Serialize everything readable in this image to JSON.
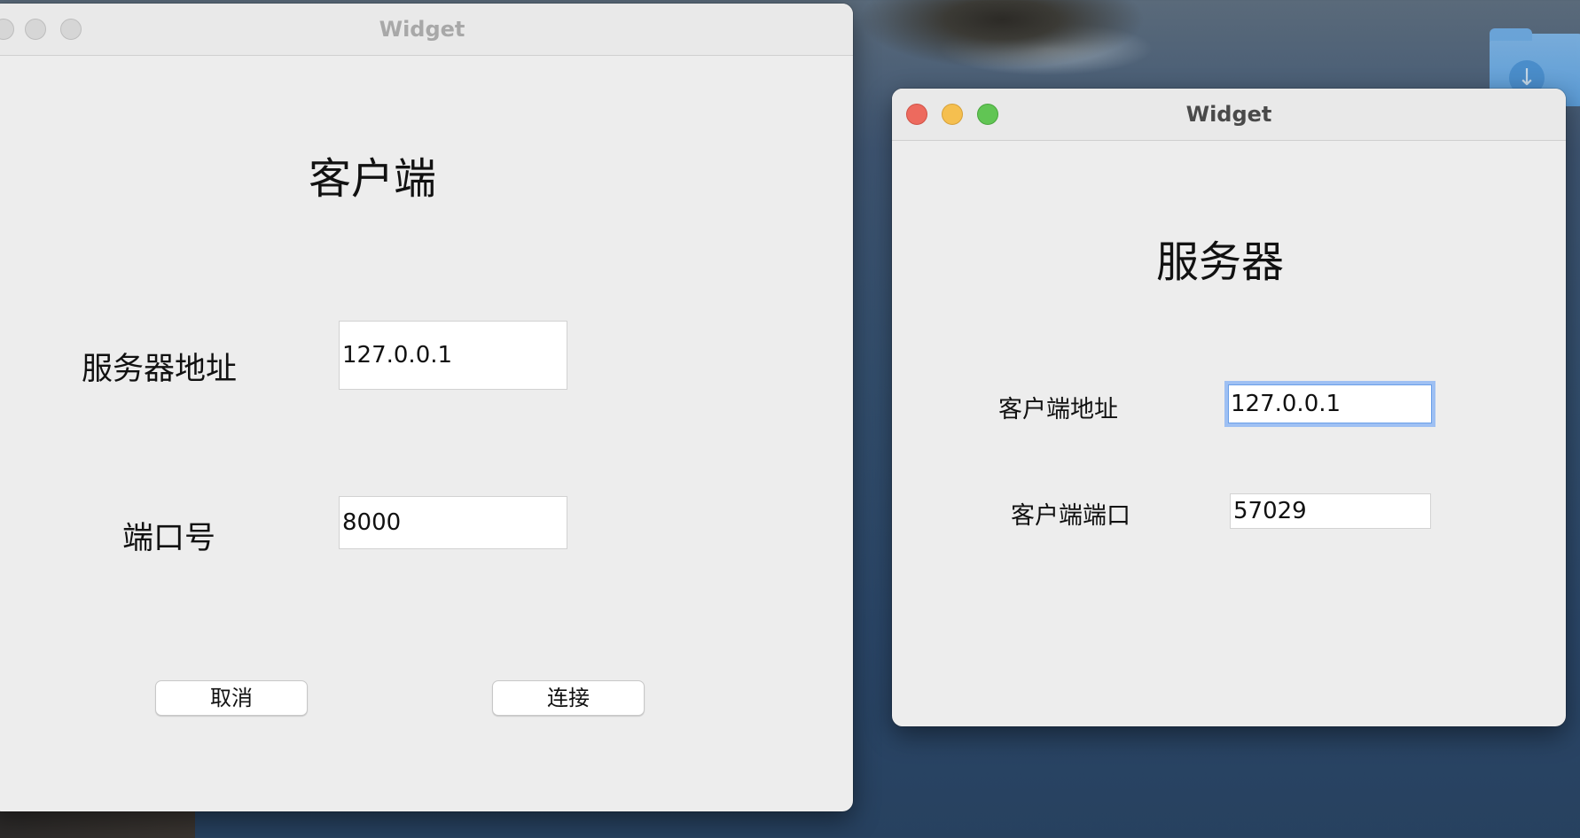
{
  "client_window": {
    "title": "Widget",
    "heading": "客户端",
    "server_address_label": "服务器地址",
    "server_address_value": "127.0.0.1",
    "port_label": "端口号",
    "port_value": "8000",
    "cancel_label": "取消",
    "connect_label": "连接"
  },
  "server_window": {
    "title": "Widget",
    "heading": "服务器",
    "client_address_label": "客户端地址",
    "client_address_value": "127.0.0.1",
    "client_port_label": "客户端端口",
    "client_port_value": "57029"
  },
  "icons": {
    "folder_arrow": "download-arrow-icon"
  },
  "colors": {
    "close": "#ed6a5e",
    "minimize": "#f5bf4f",
    "maximize": "#61c554",
    "focus_ring": "#9ec0f3"
  }
}
